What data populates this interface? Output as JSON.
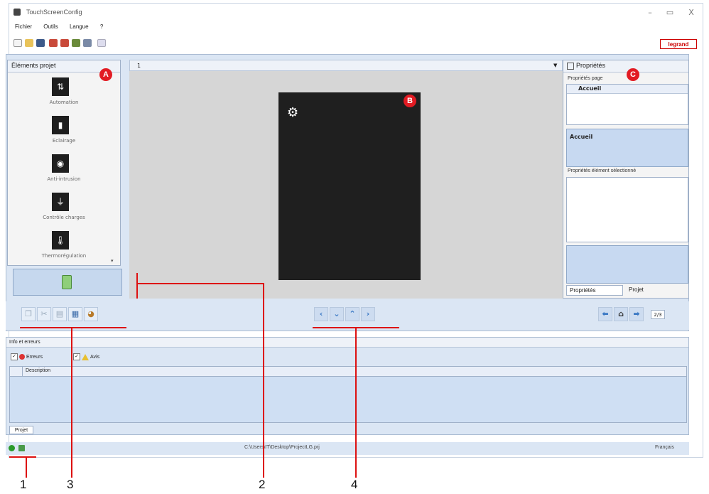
{
  "window": {
    "title": "TouchScreenConfig",
    "minimize": "–",
    "maximize": "▭",
    "close": "X"
  },
  "menu": [
    "Fichier",
    "Outils",
    "Langue",
    "?"
  ],
  "logo": "legrand",
  "left_panel": {
    "title": "Éléments projet",
    "items": [
      {
        "label": "Automation",
        "icon": "shutter-icon"
      },
      {
        "label": "Eclairage",
        "icon": "lamp-icon"
      },
      {
        "label": "Anti-intrusion",
        "icon": "alarm-icon"
      },
      {
        "label": "Contrôle charges",
        "icon": "plug-icon"
      },
      {
        "label": "Thermorégulation",
        "icon": "thermometer-icon"
      }
    ]
  },
  "center": {
    "page_selector": "1"
  },
  "right_panel": {
    "title": "Propriétés",
    "page_props_label": "Propriétés page",
    "page_value": "Accueil",
    "blue_value": "Accueil",
    "element_props_label": "Propriétés élément sélectionné",
    "tabs": [
      "Propriétés",
      "Projet"
    ]
  },
  "page_counter": "2/3",
  "info": {
    "title": "Info et erreurs",
    "errors_label": "Erreurs",
    "warnings_label": "Avis",
    "column": "Description",
    "tab": "Projet"
  },
  "status": {
    "path": "C:\\Users\\IT\\Desktop\\ProjectLG.prj",
    "language": "Français"
  },
  "badges": {
    "a": "A",
    "b": "B",
    "c": "C"
  },
  "callouts": [
    "1",
    "2",
    "3",
    "4"
  ]
}
